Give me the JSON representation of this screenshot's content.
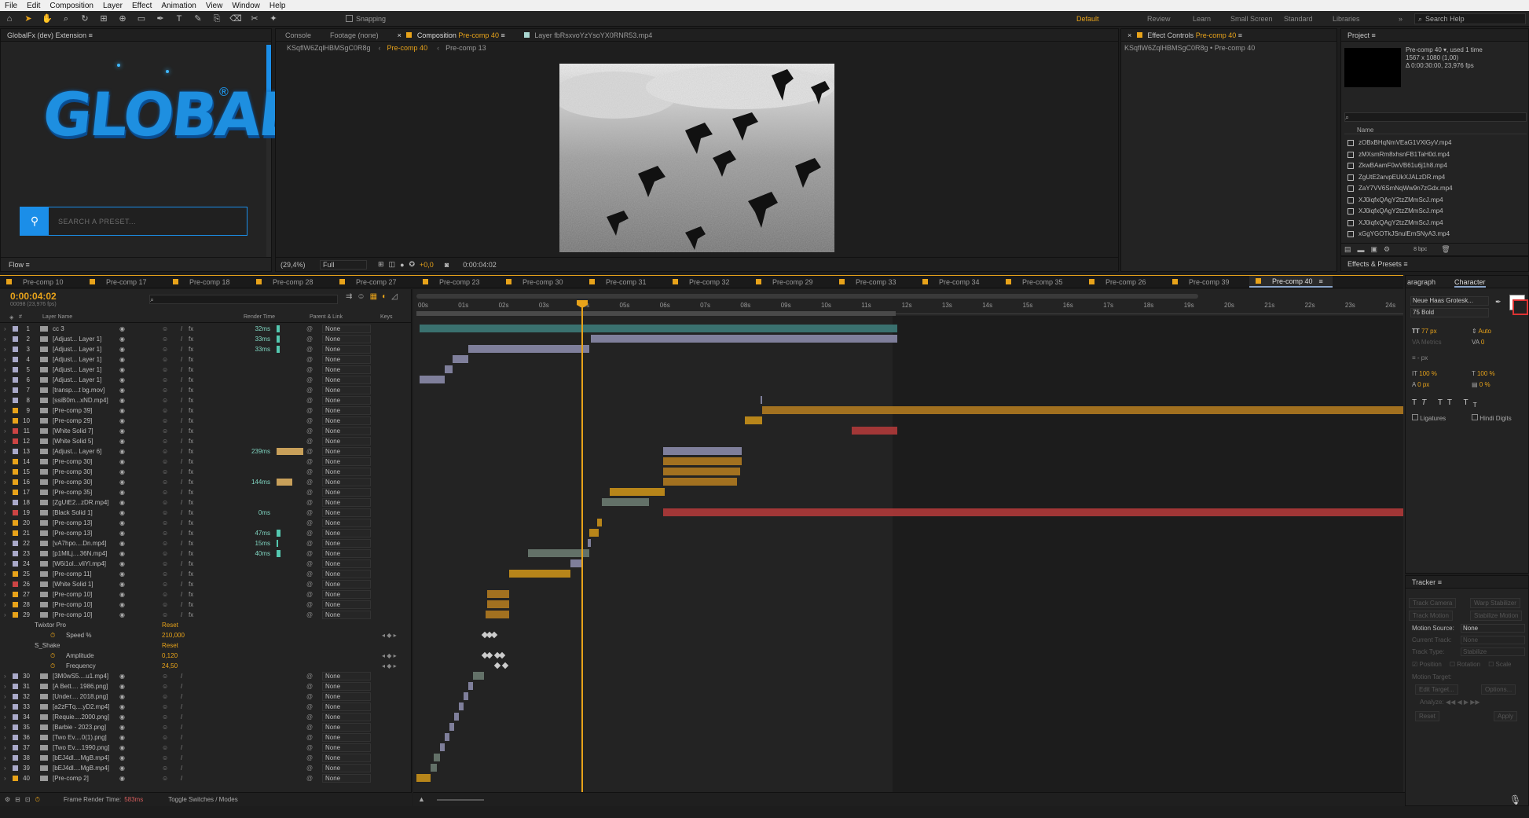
{
  "menu": [
    "File",
    "Edit",
    "Composition",
    "Layer",
    "Effect",
    "Animation",
    "View",
    "Window",
    "Help"
  ],
  "toolbar": {
    "snapping_label": "Snapping"
  },
  "workspaces": [
    {
      "label": "Default",
      "active": true
    },
    {
      "label": "Review"
    },
    {
      "label": "Learn"
    },
    {
      "label": "Small Screen"
    },
    {
      "label": "Standard"
    },
    {
      "label": "Libraries"
    }
  ],
  "help_search": {
    "placeholder": "Search Help"
  },
  "extension": {
    "title": "GlobalFx (dev) Extension",
    "logo": "GLOBALFX",
    "logo_mark": "®",
    "search_placeholder": "SEARCH A PRESET...",
    "flow_label": "Flow"
  },
  "comp_panel": {
    "tabs": [
      {
        "label": "Console"
      },
      {
        "label": "Footage (none)"
      },
      {
        "label": "Composition",
        "accent": "Pre-comp 40"
      },
      {
        "label": "Layer  fbRsxvoYzYsoYX0RNR53.mp4"
      }
    ],
    "breadcrumbs": [
      "KSqflW6ZqlHBMSgC0R8g",
      "Pre-comp 40",
      "Pre-comp 13"
    ],
    "footer": {
      "zoom": "(29,4%)",
      "quality": "Full",
      "exposure": "+0,0",
      "timecode": "0:00:04:02"
    }
  },
  "effect_controls": {
    "title": "Effect Controls",
    "accent": "Pre-comp 40",
    "sub": "KSqflW6ZqlHBMSgC0R8g • Pre-comp 40"
  },
  "project": {
    "title": "Project",
    "comp_name": "Pre-comp 40",
    "used": ", used 1 time",
    "size": "1567 x 1080 (1,00)",
    "duration": "Δ 0:00:30:00, 23,976 fps",
    "col_name": "Name",
    "bpc": "8 bpc",
    "files": [
      "zOBxBHqNmVEaG1VXlGyV.mp4",
      "zMXsmRm8xhsnFB1TaH0d.mp4",
      "ZkwBAamF0wVB61u6j1h8.mp4",
      "ZgUtE2arvpEUkXJALzDR.mp4",
      "ZaY7VV6SmNqWw9n7zGdx.mp4",
      "XJ0iqfxQAgY2tzZMmScJ.mp4",
      "XJ0iqfxQAgY2tzZMmScJ.mp4",
      "XJ0iqfxQAgY2tzZMmScJ.mp4",
      "xGgYGOTkJSnulEmSNyA3.mp4"
    ]
  },
  "effects_presets": {
    "title": "Effects & Presets"
  },
  "timeline_tabs": [
    "Pre-comp 10",
    "Pre-comp 17",
    "Pre-comp 18",
    "Pre-comp 28",
    "Pre-comp 27",
    "Pre-comp 23",
    "Pre-comp 30",
    "Pre-comp 31",
    "Pre-comp 32",
    "Pre-comp 29",
    "Pre-comp 33",
    "Pre-comp 34",
    "Pre-comp 35",
    "Pre-comp 26",
    "Pre-comp 39",
    "Pre-comp 40"
  ],
  "timeline": {
    "timecode": "0:00:04:02",
    "frames": "00098 (23,976 fps)",
    "headers": {
      "layer_name": "Layer Name",
      "render_time": "Render Time",
      "parent": "Parent & Link",
      "keys": "Keys"
    },
    "ruler": [
      "00s",
      "01s",
      "02s",
      "03s",
      "04s",
      "05s",
      "06s",
      "07s",
      "08s",
      "09s",
      "10s",
      "11s",
      "12s",
      "13s",
      "14s",
      "15s",
      "16s",
      "17s",
      "18s",
      "19s",
      "20s",
      "21s",
      "22s",
      "23s",
      "24s"
    ],
    "footer": {
      "frame_render_label": "Frame Render Time:",
      "frame_render_value": "583ms",
      "toggle": "Toggle Switches / Modes"
    },
    "props": [
      {
        "label": "Twixtor Pro",
        "value": "Reset",
        "level": 1
      },
      {
        "label": "Speed %",
        "value": "210,000",
        "level": 2
      },
      {
        "label": "S_Shake",
        "value": "Reset",
        "level": 1
      },
      {
        "label": "Amplitude",
        "value": "0,120",
        "level": 2
      },
      {
        "label": "Frequency",
        "value": "24,50",
        "level": 2
      }
    ],
    "parent_none": "None"
  },
  "layers": [
    {
      "n": "1",
      "name": "cc 3",
      "color": "#a9a9c9",
      "rt": "32ms",
      "rtw": 4
    },
    {
      "n": "2",
      "name": "[Adjust... Layer 1]",
      "color": "#a9a9c9",
      "rt": "33ms",
      "rtw": 4
    },
    {
      "n": "3",
      "name": "[Adjust... Layer 1]",
      "color": "#a9a9c9",
      "rt": "33ms",
      "rtw": 4
    },
    {
      "n": "4",
      "name": "[Adjust... Layer 1]",
      "color": "#a9a9c9",
      "rt": "",
      "rtw": 0
    },
    {
      "n": "5",
      "name": "[Adjust... Layer 1]",
      "color": "#a9a9c9",
      "rt": "",
      "rtw": 0
    },
    {
      "n": "6",
      "name": "[Adjust... Layer 1]",
      "color": "#a9a9c9",
      "rt": "",
      "rtw": 0
    },
    {
      "n": "7",
      "name": "[transp....t bg.mov]",
      "color": "#a9a9c9",
      "rt": "",
      "rtw": 0
    },
    {
      "n": "8",
      "name": "[ssiB0m...xND.mp4]",
      "color": "#a9a9c9",
      "rt": "",
      "rtw": 0
    },
    {
      "n": "9",
      "name": "[Pre-comp 39]",
      "color": "#e8a31a",
      "rt": "",
      "rtw": 0
    },
    {
      "n": "10",
      "name": "[Pre-comp 29]",
      "color": "#e8a31a",
      "rt": "",
      "rtw": 0
    },
    {
      "n": "11",
      "name": "[White Solid 7]",
      "color": "#c44",
      "rt": "",
      "rtw": 0
    },
    {
      "n": "12",
      "name": "[White Solid 5]",
      "color": "#c44",
      "rt": "",
      "rtw": 0
    },
    {
      "n": "13",
      "name": "[Adjust... Layer 6]",
      "color": "#a9a9c9",
      "rt": "239ms",
      "rtw": 34
    },
    {
      "n": "14",
      "name": "[Pre-comp 30]",
      "color": "#e8a31a",
      "rt": "",
      "rtw": 0
    },
    {
      "n": "15",
      "name": "[Pre-comp 30]",
      "color": "#e8a31a",
      "rt": "",
      "rtw": 0
    },
    {
      "n": "16",
      "name": "[Pre-comp 30]",
      "color": "#e8a31a",
      "rt": "144ms",
      "rtw": 20
    },
    {
      "n": "17",
      "name": "[Pre-comp 35]",
      "color": "#e8a31a",
      "rt": "",
      "rtw": 0
    },
    {
      "n": "18",
      "name": "[ZgUtE2...zDR.mp4]",
      "color": "#a9a9c9",
      "rt": "",
      "rtw": 0
    },
    {
      "n": "19",
      "name": "[Black Solid 1]",
      "color": "#c44",
      "rt": "0ms",
      "rtw": 0
    },
    {
      "n": "20",
      "name": "[Pre-comp 13]",
      "color": "#e8a31a",
      "rt": "",
      "rtw": 0
    },
    {
      "n": "21",
      "name": "[Pre-comp 13]",
      "color": "#e8a31a",
      "rt": "47ms",
      "rtw": 5
    },
    {
      "n": "22",
      "name": "[vA7hpo....Dn.mp4]",
      "color": "#a9a9c9",
      "rt": "15ms",
      "rtw": 2
    },
    {
      "n": "23",
      "name": "[p1MlLj....36N.mp4]",
      "color": "#a9a9c9",
      "rt": "40ms",
      "rtw": 5
    },
    {
      "n": "24",
      "name": "[W6i1ol...vliYl.mp4]",
      "color": "#a9a9c9",
      "rt": "",
      "rtw": 0
    },
    {
      "n": "25",
      "name": "[Pre-comp 11]",
      "color": "#e8a31a",
      "rt": "",
      "rtw": 0
    },
    {
      "n": "26",
      "name": "[White Solid 1]",
      "color": "#c44",
      "rt": "",
      "rtw": 0
    },
    {
      "n": "27",
      "name": "[Pre-comp 10]",
      "color": "#e8a31a",
      "rt": "",
      "rtw": 0
    },
    {
      "n": "28",
      "name": "[Pre-comp 10]",
      "color": "#e8a31a",
      "rt": "",
      "rtw": 0
    },
    {
      "n": "29",
      "name": "[Pre-comp 10]",
      "color": "#e8a31a",
      "rt": "",
      "rtw": 0
    }
  ],
  "layers2": [
    {
      "n": "30",
      "name": "[3M0wS5....u1.mp4]",
      "color": "#a9a9c9"
    },
    {
      "n": "31",
      "name": "[A Bett.... 1986.png]",
      "color": "#a9a9c9"
    },
    {
      "n": "32",
      "name": "[Under.... 2018.png]",
      "color": "#a9a9c9"
    },
    {
      "n": "33",
      "name": "[a2zFTq....yD2.mp4]",
      "color": "#a9a9c9"
    },
    {
      "n": "34",
      "name": "[Requie....2000.png]",
      "color": "#a9a9c9"
    },
    {
      "n": "35",
      "name": "[Barbie - 2023.png]",
      "color": "#a9a9c9"
    },
    {
      "n": "36",
      "name": "[Two Ev....0(1).png]",
      "color": "#a9a9c9"
    },
    {
      "n": "37",
      "name": "[Two Ev....1990.png]",
      "color": "#a9a9c9"
    },
    {
      "n": "38",
      "name": "[bEJ4dl....MgB.mp4]",
      "color": "#a9a9c9"
    },
    {
      "n": "39",
      "name": "[bEJ4dl....MgB.mp4]",
      "color": "#a9a9c9"
    },
    {
      "n": "40",
      "name": "[Pre-comp 2]",
      "color": "#e8a31a"
    }
  ],
  "character": {
    "tabs": [
      "aragraph",
      "Character"
    ],
    "font": "Neue Haas Grotesk...",
    "style": "75 Bold",
    "size": "77 px",
    "leading": "Auto",
    "metrics": "Metrics",
    "tracking": "0",
    "stroke": "- px",
    "vscale": "100 %",
    "hscale": "100 %",
    "baseline": "0 px",
    "tsume": "0 %",
    "ligatures": "Ligatures",
    "hindi": "Hindi Digits"
  },
  "tracker": {
    "title": "Tracker",
    "track_camera": "Track Camera",
    "warp_stab": "Warp Stabilizer",
    "track_motion": "Track Motion",
    "stab_motion": "Stabilize Motion",
    "motion_source_label": "Motion Source:",
    "motion_source": "None",
    "current_track": "Current Track:",
    "current_track_val": "None",
    "track_type": "Track Type:",
    "track_type_val": "Stabilize",
    "position": "Position",
    "rotation": "Rotation",
    "scale": "Scale",
    "motion_target": "Motion Target:",
    "edit_target": "Edit Target...",
    "options": "Options...",
    "analyze": "Analyze:",
    "reset": "Reset",
    "apply": "Apply"
  }
}
